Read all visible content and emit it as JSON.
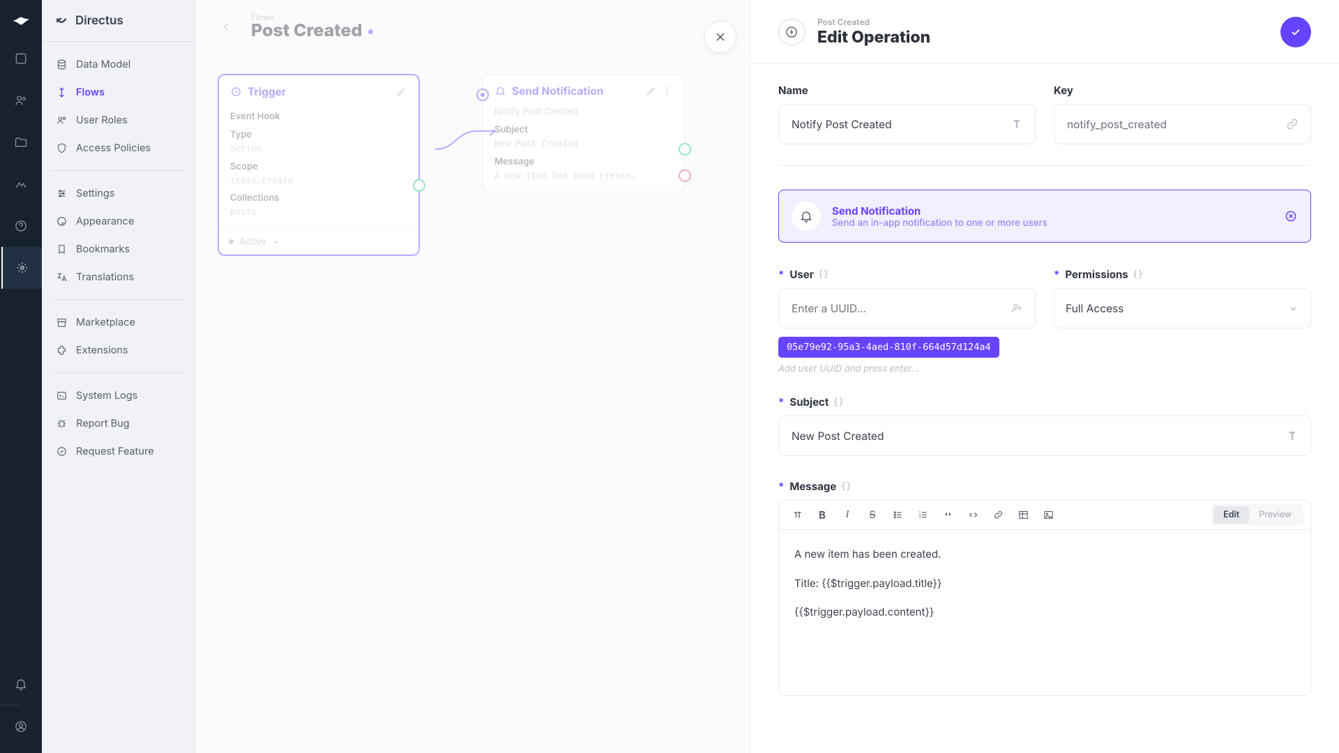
{
  "brand": "Directus",
  "sidebar": {
    "items": [
      {
        "icon": "database",
        "label": "Data Model"
      },
      {
        "icon": "flows",
        "label": "Flows"
      },
      {
        "icon": "roles",
        "label": "User Roles"
      },
      {
        "icon": "policies",
        "label": "Access Policies"
      },
      {
        "icon": "settings",
        "label": "Settings"
      },
      {
        "icon": "appearance",
        "label": "Appearance"
      },
      {
        "icon": "bookmarks",
        "label": "Bookmarks"
      },
      {
        "icon": "translations",
        "label": "Translations"
      },
      {
        "icon": "marketplace",
        "label": "Marketplace"
      },
      {
        "icon": "extensions",
        "label": "Extensions"
      },
      {
        "icon": "logs",
        "label": "System Logs"
      },
      {
        "icon": "bug",
        "label": "Report Bug"
      },
      {
        "icon": "feature",
        "label": "Request Feature"
      }
    ]
  },
  "flow": {
    "crumb": "Flows",
    "title": "Post Created",
    "status": "Active"
  },
  "trigger": {
    "title": "Trigger",
    "eventhook": "Event Hook",
    "type_label": "Type",
    "type": "action",
    "scope_label": "Scope",
    "scope": "items.create",
    "collections_label": "Collections",
    "collections": "posts"
  },
  "opNode": {
    "title": "Send Notification",
    "name": "Notify Post Created",
    "subject_label": "Subject",
    "subject": "New Post Created",
    "message_label": "Message",
    "message": "A new item has been create…"
  },
  "panel": {
    "crumb": "Post Created",
    "title": "Edit Operation",
    "nameLabel": "Name",
    "name": "Notify Post Created",
    "keyLabel": "Key",
    "key": "notify_post_created",
    "banner": {
      "title": "Send Notification",
      "sub": "Send an in-app notification to one or more users"
    },
    "userLabel": "User",
    "userPlaceholder": "Enter a UUID...",
    "userChip": "05e79e92-95a3-4aed-810f-664d57d124a4",
    "userHint": "Add user UUID and press enter...",
    "permLabel": "Permissions",
    "permValue": "Full Access",
    "subjectLabel": "Subject",
    "subjectValue": "New Post Created",
    "messageLabel": "Message",
    "editorEdit": "Edit",
    "editorPreview": "Preview",
    "messageLine1": "A new item has been created.",
    "messageLine2": "Title: {{$trigger.payload.title}}",
    "messageLine3": "{{$trigger.payload.content}}"
  },
  "brackets": "{}"
}
